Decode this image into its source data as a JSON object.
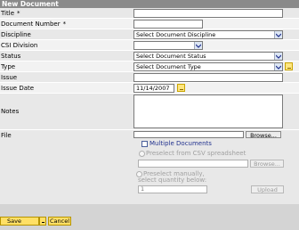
{
  "window": {
    "title": "New Document"
  },
  "fields": {
    "title": {
      "label": "Title",
      "required_mark": "*",
      "value": ""
    },
    "document_number": {
      "label": "Document Number",
      "required_mark": "*",
      "value": ""
    },
    "discipline": {
      "label": "Discipline",
      "selected": "Select Document Discipline"
    },
    "csi_division": {
      "label": "CSI Division",
      "selected": ""
    },
    "status": {
      "label": "Status",
      "selected": "Select Document Status"
    },
    "type": {
      "label": "Type",
      "selected": "Select Document Type"
    },
    "issue": {
      "label": "Issue",
      "value": ""
    },
    "issue_date": {
      "label": "Issue Date",
      "value": "11/14/2007"
    },
    "notes": {
      "label": "Notes",
      "value": ""
    },
    "file": {
      "label": "File",
      "browse_label": "Browse..."
    }
  },
  "multiple": {
    "checkbox_label": "Multiple Documents",
    "csv_radio_label": "Preselect from CSV spreadsheet",
    "csv_browse_label": "Browse...",
    "manual_radio_label_1": "Preselect manually,",
    "manual_radio_label_2": "select quantity below:",
    "quantity_value": "1",
    "upload_label": "Upload"
  },
  "actions": {
    "save_label": "Save",
    "cancel_label": "Cancel"
  },
  "colors": {
    "title_bar": "#8a8a8a",
    "button_yellow": "#ffe066",
    "accent_blue": "#23338f"
  }
}
